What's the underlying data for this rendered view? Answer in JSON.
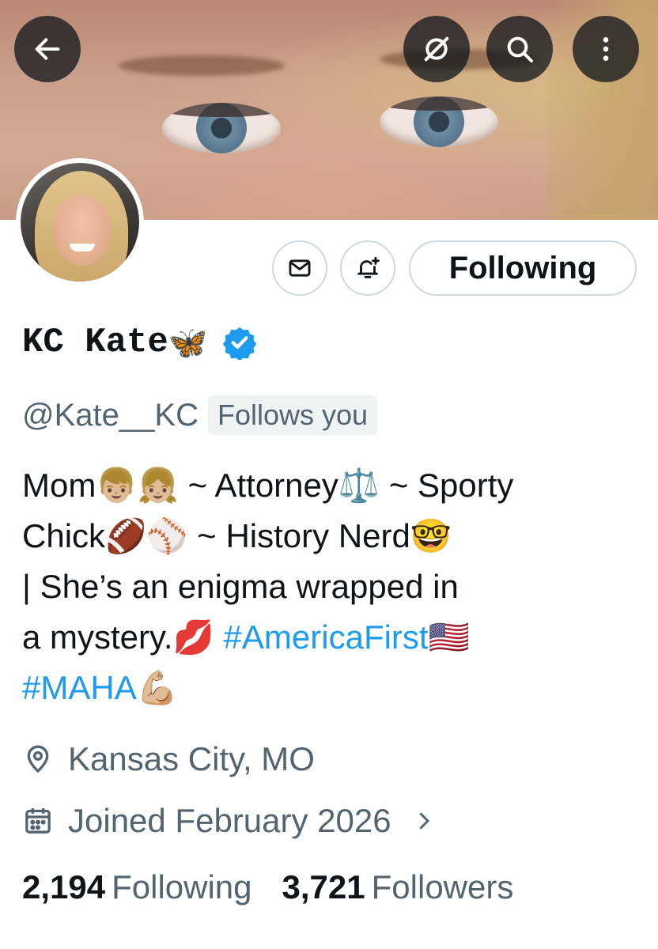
{
  "header": {
    "buttons": [
      {
        "name": "back",
        "icon": "back-arrow-icon"
      },
      {
        "name": "grok",
        "icon": "grok-slash-icon"
      },
      {
        "name": "search",
        "icon": "search-icon"
      },
      {
        "name": "more",
        "icon": "more-vertical-icon"
      }
    ]
  },
  "profile": {
    "display_name": "KC Kate",
    "name_emoji": "🦋",
    "verified": true,
    "handle": "@Kate__KC",
    "follows_you_badge": "Follows you",
    "actions": {
      "message_icon": "mail-icon",
      "notify_icon": "bell-plus-icon",
      "following_label": "Following"
    },
    "bio": {
      "line1": "Mom👦🏼👧🏼 ~ Attorney⚖️ ~ Sporty",
      "line2": "Chick🏈⚾ ~ History Nerd🤓",
      "line3": "| She’s an enigma wrapped in",
      "line4_text": "a mystery.💋 ",
      "hashtag1": "#AmericaFirst🇺🇸",
      "hashtag2": "#MAHA💪🏼"
    },
    "location": "Kansas City, MO",
    "joined": "Joined February 2026",
    "following_count": "2,194",
    "following_label": "Following",
    "followers_count": "3,721",
    "followers_label": "Followers"
  },
  "colors": {
    "accent": "#1d9bf0",
    "secondary_text": "#536471",
    "primary_text": "#0f1419",
    "border": "#cfd9de"
  }
}
